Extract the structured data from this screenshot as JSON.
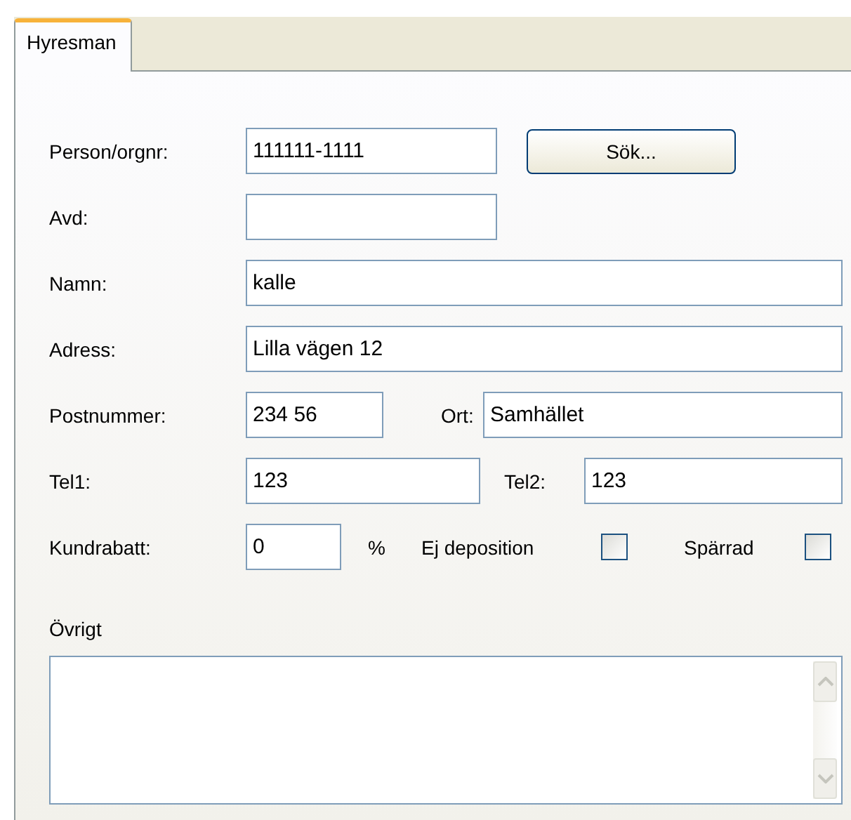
{
  "tabs": [
    {
      "label": "Hyresman",
      "selected": true
    }
  ],
  "person": {
    "label": "Person/orgnr:",
    "value": "111111-1111"
  },
  "search_button": "Sök...",
  "avd": {
    "label": "Avd:"
  },
  "namn": {
    "label": "Namn:",
    "value": "kalle"
  },
  "adress": {
    "label": "Adress:",
    "value": "Lilla vägen 12"
  },
  "postnummer": {
    "label": "Postnummer:",
    "value": "234 56"
  },
  "ort": {
    "label": "Ort:",
    "value": "Samhället"
  },
  "tel1": {
    "label": "Tel1:",
    "value": "123"
  },
  "tel2": {
    "label": "Tel2:",
    "value": "123"
  },
  "kundrabatt": {
    "label": "Kundrabatt:",
    "value": "0",
    "unit": "%"
  },
  "ej_deposition": {
    "label": "Ej deposition",
    "checked": false
  },
  "sparrad": {
    "label": "Spärrad",
    "checked": false
  },
  "ovrigt": {
    "label": "Övrigt"
  }
}
